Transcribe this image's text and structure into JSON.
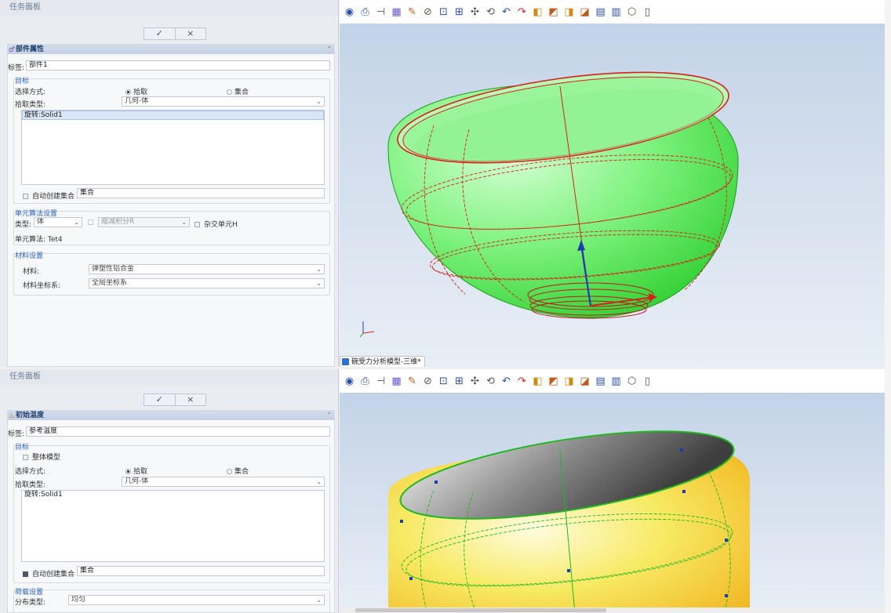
{
  "colors": {
    "accent": "#2d63b8",
    "panel_bg": "#e9edf2",
    "viewport_bg": "#c3d3e7",
    "bowl_green": "#4fe54f",
    "bowl_yellow": "#f2d826",
    "mesh_red": "#d8201a"
  },
  "top": {
    "panel_title": "任务面板",
    "ok_label": "✓",
    "cancel_label": "×",
    "section_title": "部件属性",
    "label_caption": "标签:",
    "label_value": "部件1",
    "target": {
      "title": "目标",
      "select_mode_label": "选择方式:",
      "option_pick": "拾取",
      "option_set": "集合",
      "pick_type_label": "拾取类型:",
      "pick_type_value": "几何-体",
      "list_items": [
        "旋转:Solid1"
      ],
      "auto_create_label": "自动创建集合",
      "set_value": "集合"
    },
    "element": {
      "title": "单元算法设置",
      "type_label": "类型:",
      "type_value": "体",
      "reduced_label": "缩减积分R",
      "hybrid_label": "杂交单元H",
      "algorithm_text": "单元算法: Tet4"
    },
    "material": {
      "title": "材料设置",
      "material_label": "材料:",
      "material_value": "弹塑性铝合金",
      "csys_label": "材料坐标系:",
      "csys_value": "全局坐标系"
    },
    "viewport_tab": "碗受力分析模型-三维*"
  },
  "bottom": {
    "panel_title": "任务面板",
    "ok_label": "✓",
    "cancel_label": "×",
    "section_title": "初始温度",
    "label_caption": "标签:",
    "label_value": "参考温度",
    "target": {
      "title": "目标",
      "whole_model_label": "整体模型",
      "select_mode_label": "选择方式:",
      "option_pick": "拾取",
      "option_set": "集合",
      "pick_type_label": "拾取类型:",
      "pick_type_value": "几何-体",
      "list_items": [
        "旋转:Solid1"
      ],
      "auto_create_label": "自动创建集合",
      "set_value": "集合"
    },
    "load": {
      "title": "荷载设置",
      "distribution_label": "分布类型:",
      "distribution_value": "均匀"
    }
  },
  "toolbar_icons": [
    "camera-icon",
    "print-icon",
    "measure-icon",
    "display-style-icon",
    "color-icon",
    "transparency-icon",
    "zoom-box-icon",
    "zoom-fit-icon",
    "pan-icon",
    "rotate-icon",
    "undo-view-icon",
    "redo-view-icon",
    "view-front-icon",
    "view-section-icon",
    "view-back-icon",
    "view-section-2-icon",
    "view-left-icon",
    "view-right-icon",
    "view-iso-icon",
    "view-cube-icon"
  ]
}
